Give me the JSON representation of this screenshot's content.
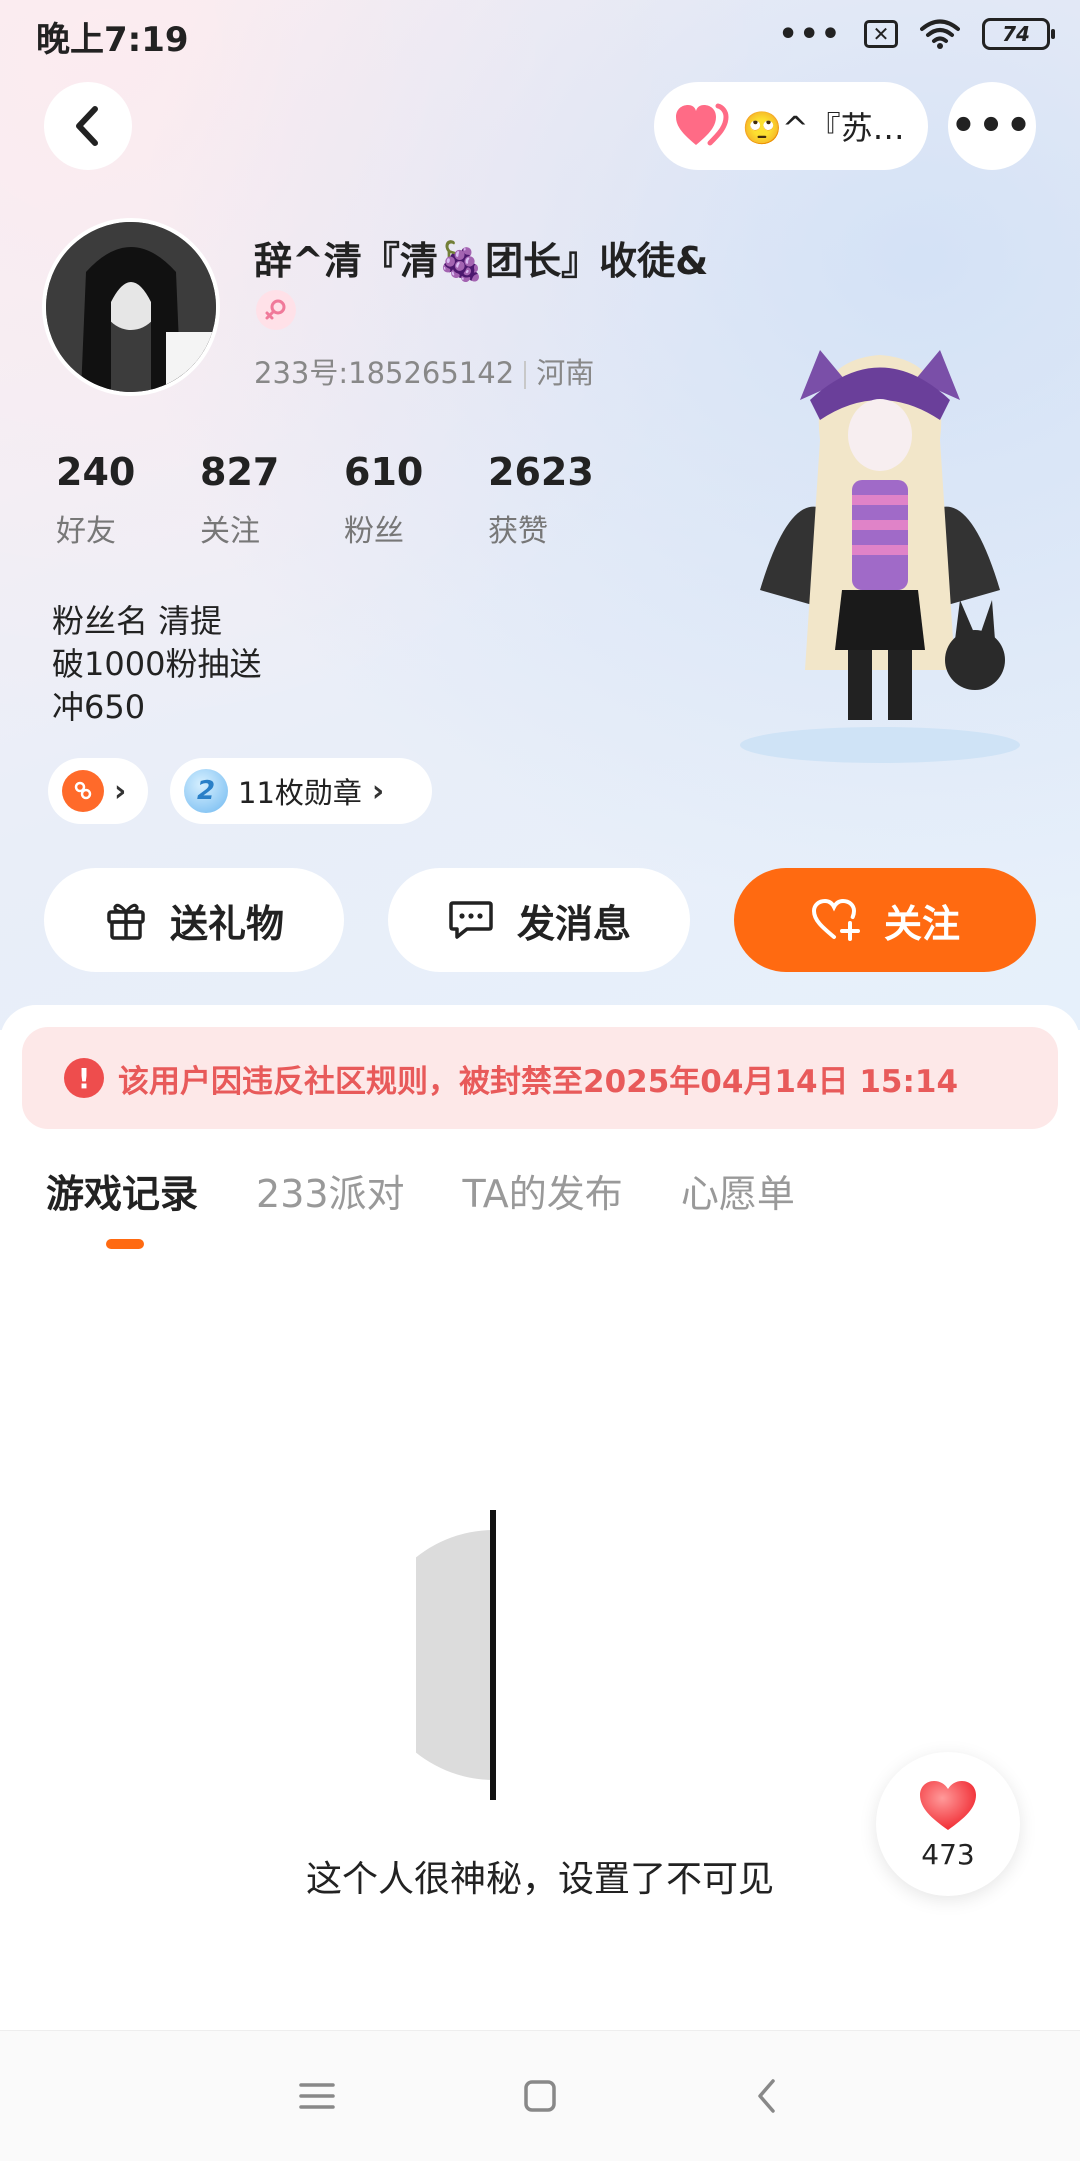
{
  "status_bar": {
    "time": "晚上7:19",
    "battery": "74",
    "icons": [
      "more-dots-icon",
      "close-box-icon",
      "wifi-icon",
      "battery-icon"
    ]
  },
  "top_nav": {
    "visitor_text": "🙄^『苏…",
    "icons": [
      "back-arrow-icon",
      "heart-icon",
      "more-icon"
    ]
  },
  "profile": {
    "username": "辞^清『清🍇团长』收徒&",
    "id_text": "233号:185265142",
    "location": "河南",
    "gender_icon": "female-icon"
  },
  "stats": [
    {
      "value": "240",
      "label": "好友"
    },
    {
      "value": "827",
      "label": "关注"
    },
    {
      "value": "610",
      "label": "粉丝"
    },
    {
      "value": "2623",
      "label": "获赞"
    }
  ],
  "bio": {
    "line1": "粉丝名 清提",
    "line2": "破1000粉抽送",
    "line3": "冲650"
  },
  "chips": {
    "badge_count_label": "11枚勋章"
  },
  "actions": {
    "gift": "送礼物",
    "message": "发消息",
    "follow": "关注"
  },
  "ban_notice": "该用户因违反社区规则，被封禁至2025年04月14日 15:14",
  "tabs": [
    {
      "label": "游戏记录",
      "active": true
    },
    {
      "label": "233派对",
      "active": false
    },
    {
      "label": "TA的发布",
      "active": false
    },
    {
      "label": "心愿单",
      "active": false
    }
  ],
  "empty_state": "这个人很神秘，设置了不可见",
  "like_float": {
    "count": "473"
  },
  "colors": {
    "accent": "#ff6a11",
    "ban_text": "#e85a5a",
    "ban_bg": "#fde8e8"
  }
}
